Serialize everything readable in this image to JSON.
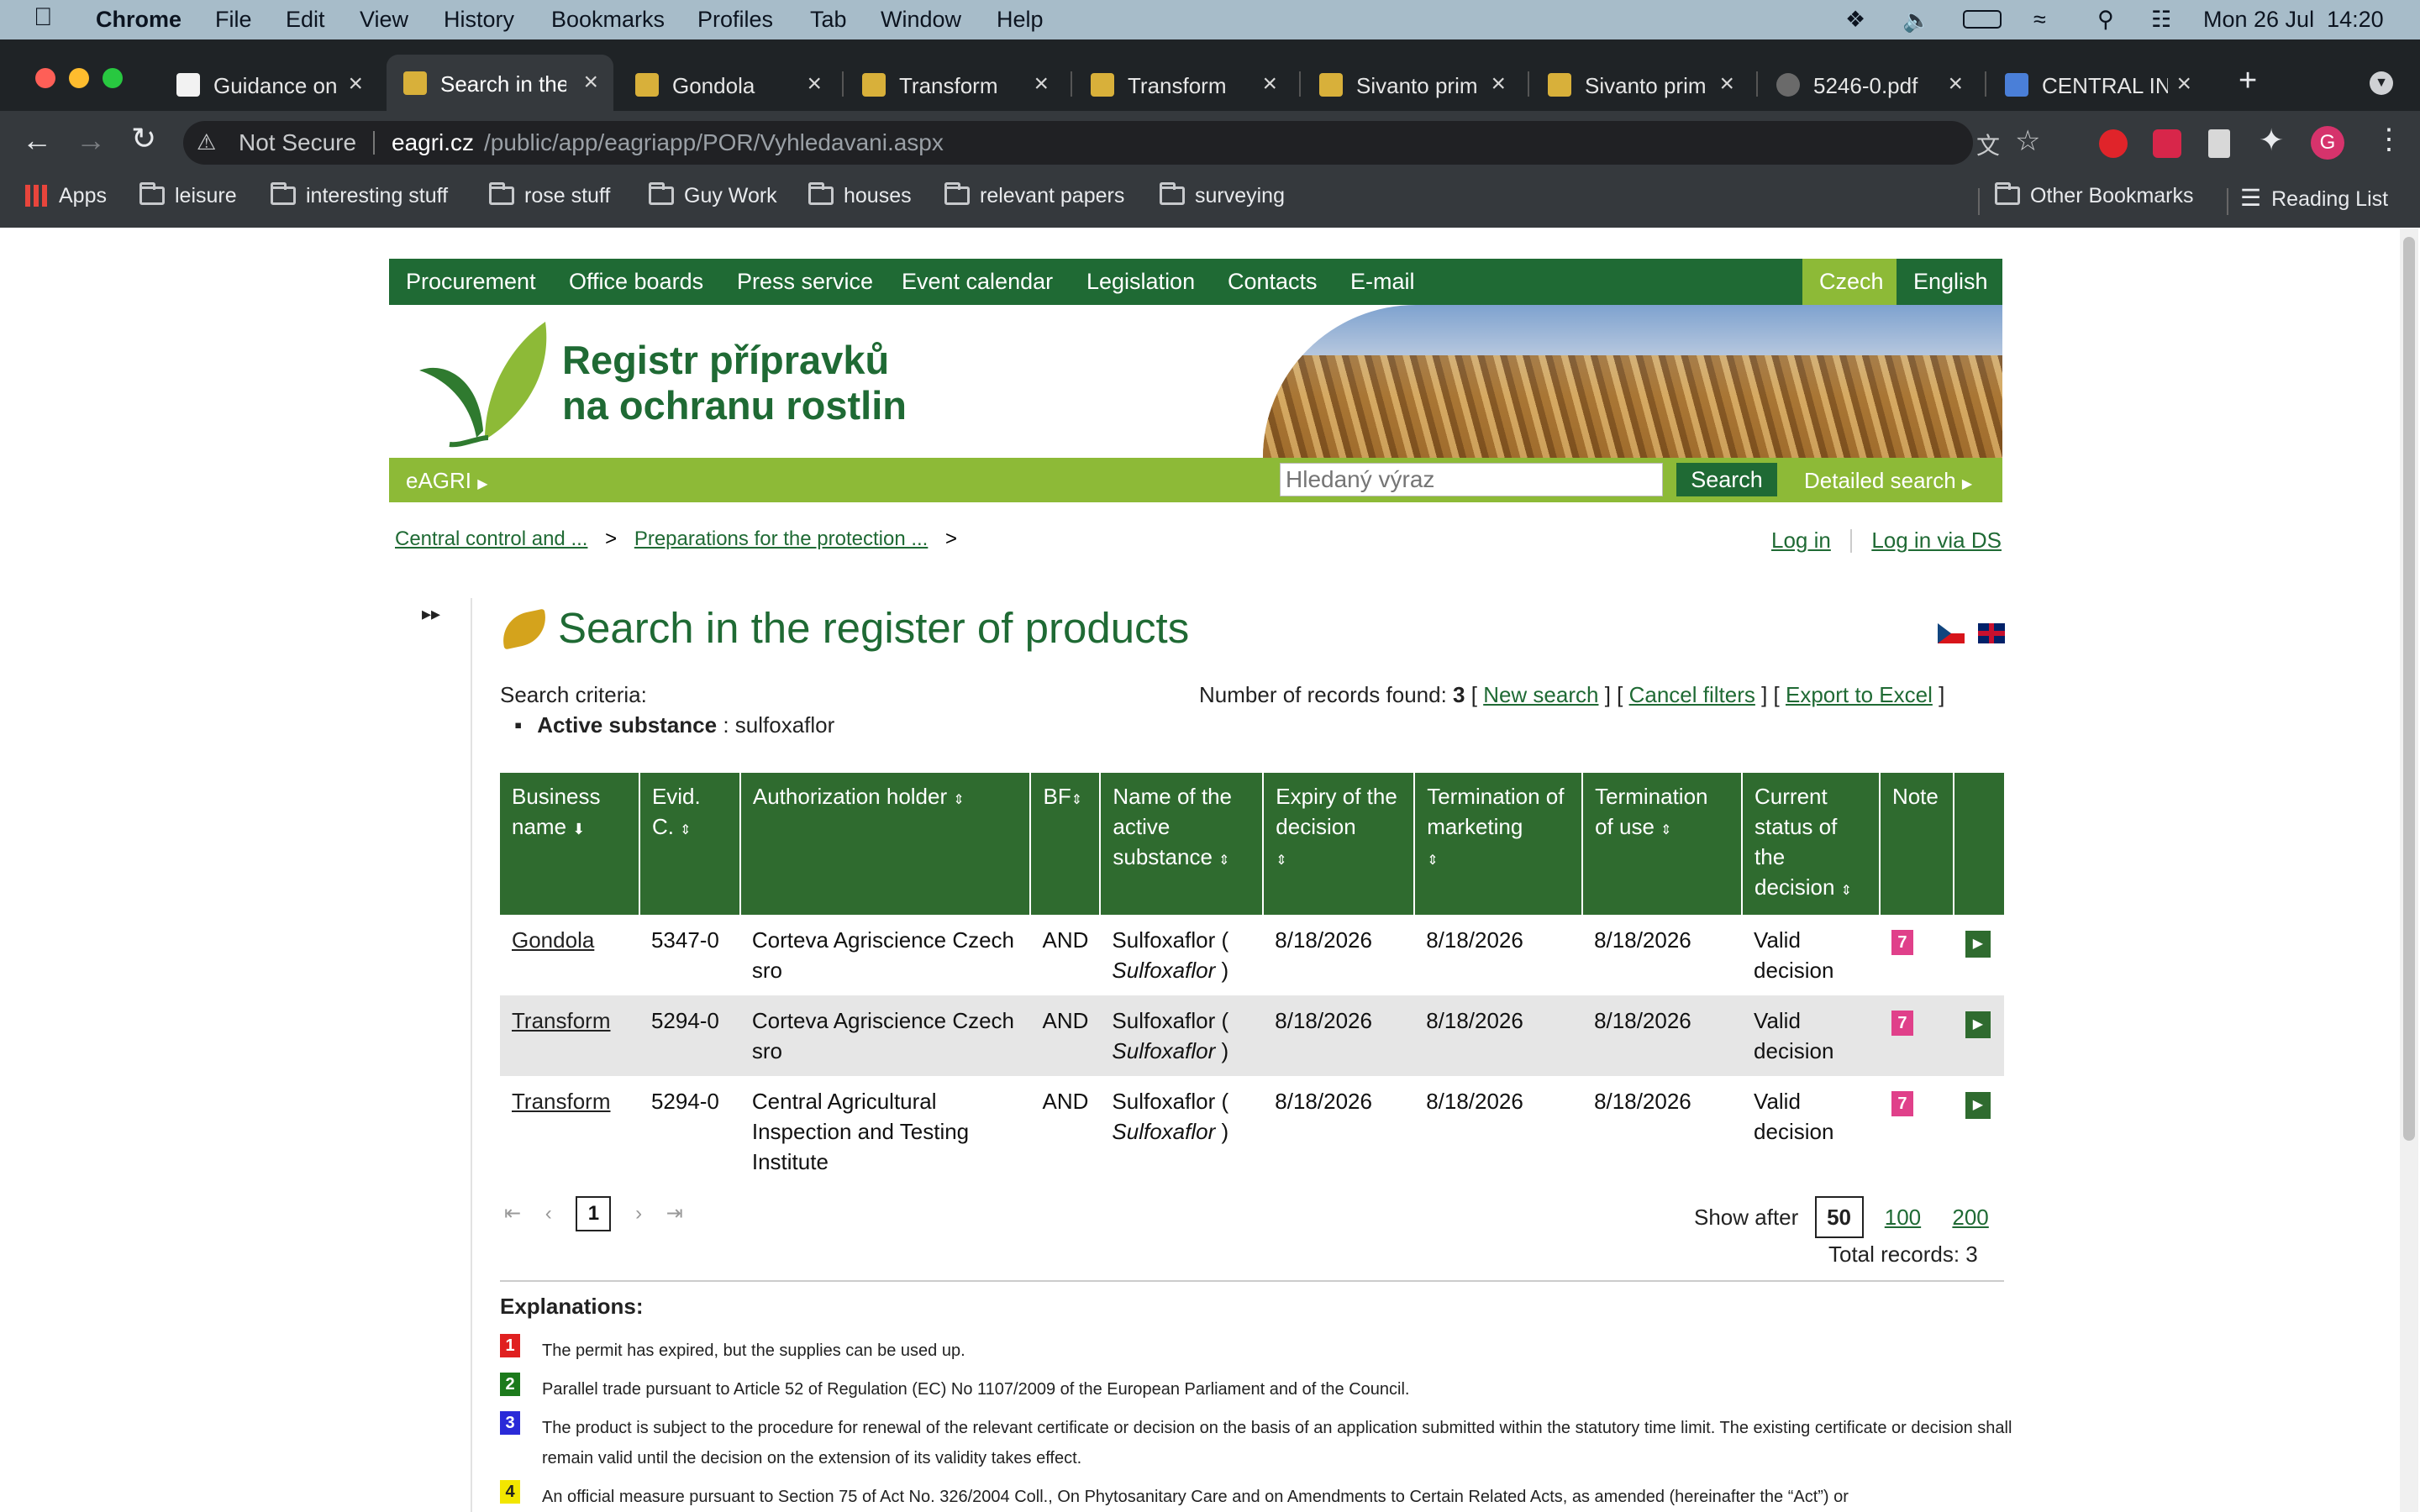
{
  "menubar": {
    "app": "Chrome",
    "items": [
      "File",
      "Edit",
      "View",
      "History",
      "Bookmarks",
      "Profiles",
      "Tab",
      "Window",
      "Help"
    ],
    "clock": "Mon 26 Jul  14:20"
  },
  "tabs": [
    {
      "title": "Guidance on"
    },
    {
      "title": "Search in the"
    },
    {
      "title": "Gondola"
    },
    {
      "title": "Transform"
    },
    {
      "title": "Transform"
    },
    {
      "title": "Sivanto prim"
    },
    {
      "title": "Sivanto prim"
    },
    {
      "title": "5246-0.pdf"
    },
    {
      "title": "CENTRAL IN"
    }
  ],
  "address": {
    "security": "Not Secure",
    "domain": "eagri.cz",
    "path": "/public/app/eagriapp/POR/Vyhledavani.aspx"
  },
  "bookmarks": {
    "apps": "Apps",
    "items": [
      "leisure",
      "interesting stuff",
      "rose stuff",
      "Guy Work",
      "houses",
      "relevant papers",
      "surveying"
    ],
    "other": "Other Bookmarks",
    "reading": "Reading List"
  },
  "site": {
    "nav": [
      "Procurement",
      "Office boards",
      "Press service",
      "Event calendar",
      "Legislation",
      "Contacts",
      "E-mail"
    ],
    "lang": {
      "cz": "Czech",
      "en": "English"
    },
    "logo_line1": "Registr přípravků",
    "logo_line2": "na ochranu rostlin",
    "eagri": "eAGRI",
    "search_placeholder": "Hledaný výraz",
    "search_button": "Search",
    "detailed_search": "Detailed search"
  },
  "breadcrumb": {
    "b1": "Central control and ...",
    "b2": "Preparations for the protection ..."
  },
  "login": {
    "login": "Log in",
    "login_ds": "Log in via DS"
  },
  "main": {
    "title": "Search in the register of products",
    "criteria_label": "Search criteria:",
    "criteria_key": "Active substance",
    "criteria_value": ": sulfoxaflor",
    "records_label": "Number of records found:",
    "records_count": "3",
    "new_search": "New search",
    "cancel_filters": "Cancel filters",
    "export_excel": "Export to Excel"
  },
  "table": {
    "headers": {
      "business_name": "Business name",
      "evid": "Evid. C.",
      "holder": "Authorization holder",
      "bf": "BF",
      "active": "Name of the active substance",
      "expiry": "Expiry of the decision",
      "term_marketing": "Termination of marketing",
      "term_use": "Termination of use",
      "status": "Current status of the decision",
      "note": "Note"
    },
    "rows": [
      {
        "name": "Gondola",
        "evid": "5347-0",
        "holder": "Corteva Agriscience Czech sro",
        "bf": "AND",
        "active": "Sulfoxaflor (",
        "active_it": "Sulfoxaflor",
        "expiry": "8/18/2026",
        "term_marketing": "8/18/2026",
        "term_use": "8/18/2026",
        "status": "Valid decision",
        "note": "7"
      },
      {
        "name": "Transform",
        "evid": "5294-0",
        "holder": "Corteva Agriscience Czech sro",
        "bf": "AND",
        "active": "Sulfoxaflor (",
        "active_it": "Sulfoxaflor",
        "expiry": "8/18/2026",
        "term_marketing": "8/18/2026",
        "term_use": "8/18/2026",
        "status": "Valid decision",
        "note": "7"
      },
      {
        "name": "Transform",
        "evid": "5294-0",
        "holder": "Central Agricultural Inspection and Testing Institute",
        "bf": "AND",
        "active": "Sulfoxaflor (",
        "active_it": "Sulfoxaflor",
        "expiry": "8/18/2026",
        "term_marketing": "8/18/2026",
        "term_use": "8/18/2026",
        "status": "Valid decision",
        "note": "7"
      }
    ]
  },
  "pager": {
    "page": "1",
    "show_after": "Show after",
    "sizes": [
      "50",
      "100",
      "200"
    ],
    "total": "Total records: 3"
  },
  "explanations": {
    "title": "Explanations:",
    "items": [
      {
        "num": "1",
        "color": "#e02020",
        "text": "The permit has expired, but the supplies can be used up."
      },
      {
        "num": "2",
        "color": "#1c7a1c",
        "text": "Parallel trade pursuant to Article 52 of Regulation (EC) No 1107/2009 of the European Parliament and of the Council."
      },
      {
        "num": "3",
        "color": "#2a2ad8",
        "text": "The product is subject to the procedure for renewal of the relevant certificate or decision on the basis of an application submitted within the statutory time limit. The existing certificate or decision shall remain valid until the decision on the extension of its validity takes effect."
      },
      {
        "num": "4",
        "color": "#f2e600",
        "text": "An official measure pursuant to Section 75 of Act No. 326/2004 Coll., On Phytosanitary Care and on Amendments to Certain Related Acts, as amended (hereinafter the “Act”) or"
      }
    ]
  }
}
